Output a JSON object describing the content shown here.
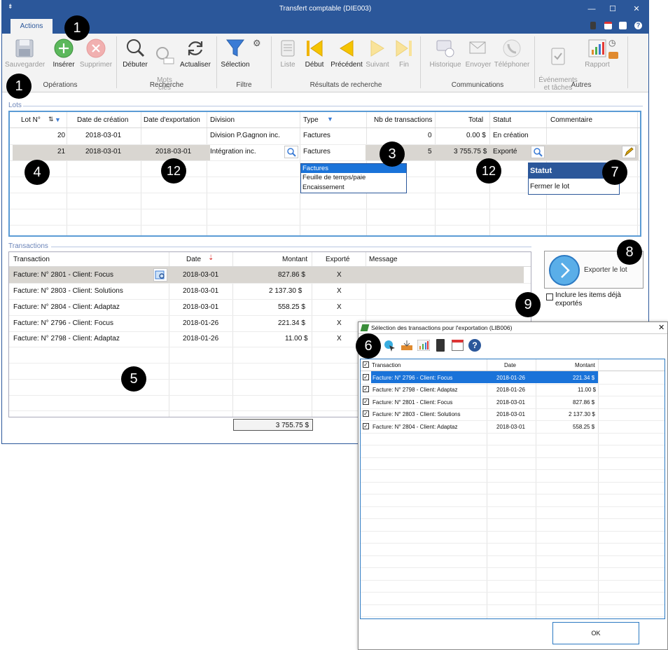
{
  "window": {
    "title": "Transfert comptable (DIE003)",
    "tab": "Actions"
  },
  "ribbon": {
    "buttons": {
      "save": "Sauvegarder",
      "insert": "Insérer",
      "delete": "Supprimer",
      "start": "Débuter",
      "keywords": "Mots\nclés",
      "refresh": "Actualiser",
      "selection": "Sélection",
      "list": "Liste",
      "first": "Début",
      "previous": "Précédent",
      "next": "Suivant",
      "last": "Fin",
      "history": "Historique",
      "send": "Envoyer",
      "phone": "Téléphoner",
      "events": "Événements\net tâches",
      "report": "Rapport"
    },
    "groups": {
      "operations": "Opérations",
      "search": "Recherche",
      "filter": "Filtre",
      "results": "Résultats de recherche",
      "communications": "Communications",
      "other": "Autres"
    }
  },
  "lots": {
    "caption": "Lots",
    "columns": [
      "Lot N°",
      "Date de création",
      "Date d'exportation",
      "Division",
      "Type",
      "Nb de transactions",
      "Total",
      "Statut",
      "Commentaire"
    ],
    "rows": [
      {
        "lot": "20",
        "created": "2018-03-01",
        "exported": "",
        "division": "Division P.Gagnon inc.",
        "type": "Factures",
        "count": "0",
        "total": "0.00 $",
        "status": "En création",
        "comment": ""
      },
      {
        "lot": "21",
        "created": "2018-03-01",
        "exported": "2018-03-01",
        "division": "Intégration inc.",
        "type": "Factures",
        "count": "5",
        "total": "3 755.75 $",
        "status": "Exporté",
        "comment": ""
      }
    ],
    "type_options": [
      "Factures",
      "Feuille de temps/paie",
      "Encaissement"
    ],
    "status_menu": {
      "header": "Statut",
      "item": "Fermer le lot"
    }
  },
  "transactions": {
    "caption": "Transactions",
    "columns": [
      "Transaction",
      "Date",
      "Montant",
      "Exporté",
      "Message"
    ],
    "rows": [
      {
        "transaction": "Facture: N° 2801 - Client: Focus",
        "date": "2018-03-01",
        "amount": "827.86 $",
        "exported": "X",
        "message": ""
      },
      {
        "transaction": "Facture: N° 2803 - Client: Solutions",
        "date": "2018-03-01",
        "amount": "2 137.30 $",
        "exported": "X",
        "message": ""
      },
      {
        "transaction": "Facture: N° 2804 - Client: Adaptaz",
        "date": "2018-03-01",
        "amount": "558.25 $",
        "exported": "X",
        "message": ""
      },
      {
        "transaction": "Facture: N° 2796 - Client: Focus",
        "date": "2018-01-26",
        "amount": "221.34 $",
        "exported": "X",
        "message": ""
      },
      {
        "transaction": "Facture: N° 2798 - Client: Adaptaz",
        "date": "2018-01-26",
        "amount": "11.00 $",
        "exported": "X",
        "message": ""
      }
    ],
    "total": "3 755.75 $"
  },
  "export": {
    "button": "Exporter le lot",
    "include_exported": "Inclure les items déjà\nexportés"
  },
  "dialog": {
    "title": "Sélection des transactions pour l'exportation (LIB006)",
    "columns": [
      "Transaction",
      "Date",
      "Montant"
    ],
    "rows": [
      {
        "transaction": "Facture: N° 2796 - Client: Focus",
        "date": "2018-01-26",
        "amount": "221.34 $"
      },
      {
        "transaction": "Facture: N° 2798 - Client: Adaptaz",
        "date": "2018-01-26",
        "amount": "11.00 $"
      },
      {
        "transaction": "Facture: N° 2801 - Client: Focus",
        "date": "2018-03-01",
        "amount": "827.86 $"
      },
      {
        "transaction": "Facture: N° 2803 - Client: Solutions",
        "date": "2018-03-01",
        "amount": "2 137.30 $"
      },
      {
        "transaction": "Facture: N° 2804 - Client: Adaptaz",
        "date": "2018-03-01",
        "amount": "558.25 $"
      }
    ],
    "ok": "OK"
  },
  "badges": [
    "1",
    "1",
    "3",
    "4",
    "12",
    "12",
    "7",
    "8",
    "9",
    "5",
    "6"
  ],
  "colors": {
    "title_bar": "#2b579a",
    "selected_row": "#d9d6d1",
    "dialog_selection": "#1a73d9",
    "badge": "#000000",
    "ribbon": "#f3f3f3"
  }
}
